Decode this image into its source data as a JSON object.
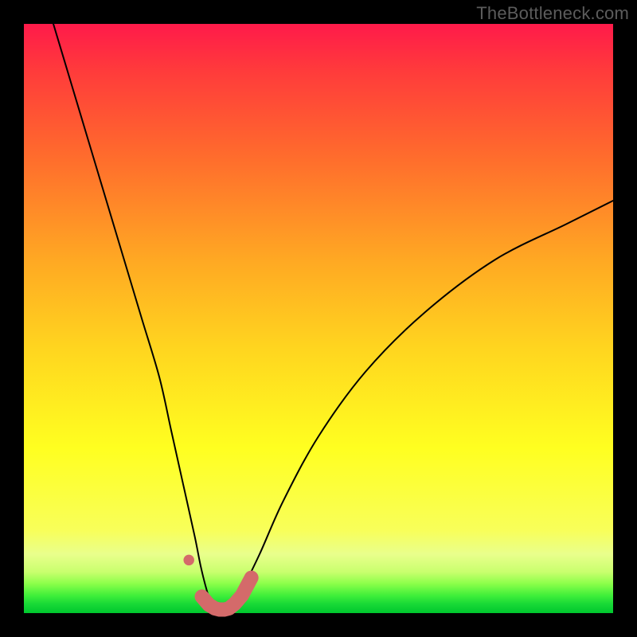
{
  "watermark": "TheBottleneck.com",
  "chart_data": {
    "type": "line",
    "title": "",
    "xlabel": "",
    "ylabel": "",
    "xlim": [
      0,
      100
    ],
    "ylim": [
      0,
      100
    ],
    "grid": false,
    "legend": false,
    "background_gradient_meaning": "bottleneck severity (top=red=high, bottom=green=low)",
    "series": [
      {
        "name": "bottleneck-curve",
        "color": "#000000",
        "stroke_width": 2,
        "x": [
          5,
          8,
          11,
          14,
          17,
          20,
          23,
          25,
          27,
          29,
          30,
          31,
          32,
          33,
          34,
          35,
          37,
          40,
          44,
          50,
          58,
          68,
          80,
          92,
          100
        ],
        "y": [
          100,
          90,
          80,
          70,
          60,
          50,
          40,
          31,
          22,
          13,
          8,
          4,
          1,
          0,
          0,
          1,
          4,
          10,
          19,
          30,
          41,
          51,
          60,
          66,
          70
        ]
      },
      {
        "name": "bottom-markers",
        "color": "#d46a6a",
        "type": "scatter",
        "marker_size_px": 18,
        "x": [
          28.0,
          30.2,
          31.4,
          32.4,
          33.2,
          34.0,
          34.8,
          35.8,
          37.0,
          38.6
        ],
        "y": [
          9.0,
          2.8,
          1.4,
          0.8,
          0.6,
          0.6,
          0.8,
          1.6,
          3.0,
          6.0
        ]
      }
    ],
    "annotations": []
  }
}
